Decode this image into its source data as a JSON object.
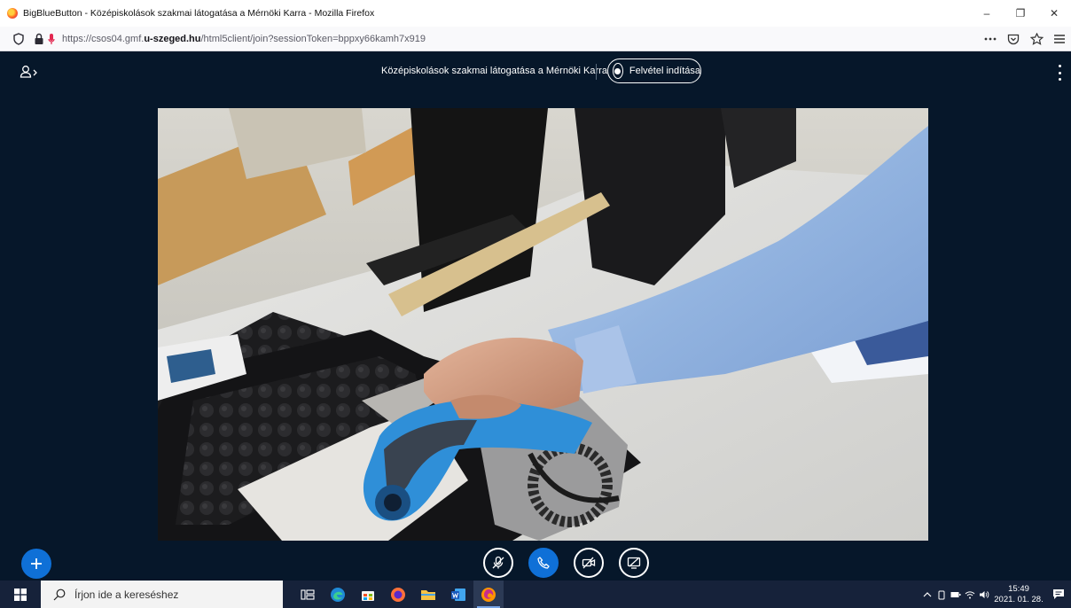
{
  "browser": {
    "window_title": "BigBlueButton - Középiskolások szakmai látogatása a Mérnöki Karra - Mozilla Firefox",
    "url_prefix": "https://csos04.gmf.",
    "url_domain": "u-szeged.hu",
    "url_path": "/html5client/join?sessionToken=bppxy66kamh7x919",
    "controls": {
      "minimize": "–",
      "restore": "❐",
      "close": "✕"
    },
    "toolbar_icons": [
      "more-icon",
      "pocket-icon",
      "bookmark-star-icon",
      "menu-icon"
    ]
  },
  "bbb": {
    "meeting_title": "Középiskolások szakmai látogatása a Mérnöki Karra",
    "record_label": "Felvétel indítása",
    "accent_color": "#0f70d7",
    "background_color": "#06172a",
    "actions": [
      "mute-microphone",
      "leave-audio",
      "share-webcam",
      "share-screen"
    ]
  },
  "taskbar": {
    "search_placeholder": "Írjon ide a kereséshez",
    "apps": [
      "task-view",
      "edge",
      "store",
      "firefox-orange",
      "file-explorer",
      "word",
      "firefox"
    ],
    "time": "15:49",
    "date": "2021. 01. 28."
  }
}
